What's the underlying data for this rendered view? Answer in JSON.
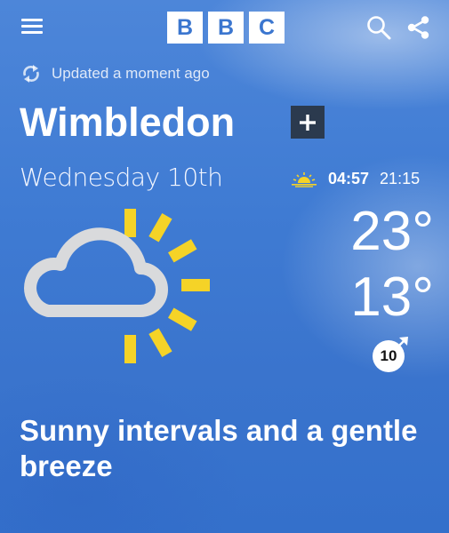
{
  "header": {
    "logo_letters": [
      "B",
      "B",
      "C"
    ],
    "icons": [
      "menu-icon",
      "search-icon",
      "share-icon"
    ]
  },
  "status": {
    "updated": "Updated a moment ago",
    "icon": "refresh-icon"
  },
  "location": {
    "name": "Wimbledon",
    "add_icon": "plus-icon"
  },
  "forecast": {
    "day": "Wednesday 10th",
    "sunrise": "04:57",
    "sunset": "21:15",
    "sun_icon": "sunrise-icon",
    "high": "23°",
    "low": "13°",
    "wind_speed": "10",
    "wind_icon": "wind-direction-arrow-icon",
    "weather_icon": "sunny-intervals-icon",
    "summary": "Sunny intervals and a gentle breeze"
  },
  "colors": {
    "sun": "#f5d327",
    "cloud": "#d9dadc",
    "logo_text": "#3b76cf",
    "add_button": "#2b3a4e"
  }
}
